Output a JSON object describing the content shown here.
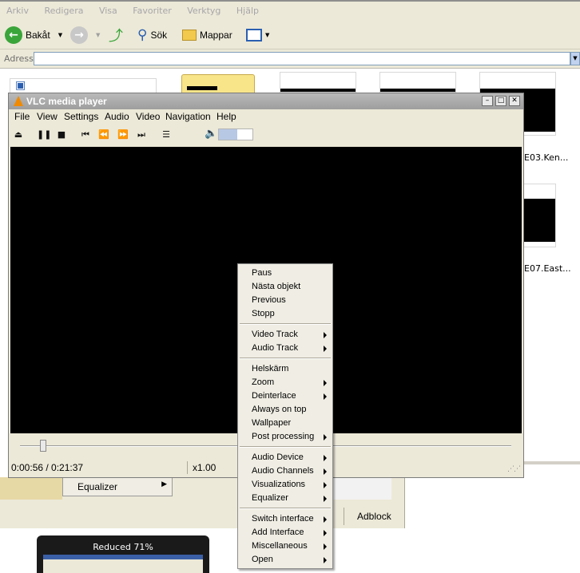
{
  "explorer": {
    "menu": [
      "Arkiv",
      "Redigera",
      "Visa",
      "Favoriter",
      "Verktyg",
      "Hjälp"
    ],
    "toolbar": {
      "back_label": "Bakåt",
      "search_label": "Sök",
      "folders_label": "Mappar"
    },
    "address_label": "Adress",
    "thumb_labels": [
      "E03.Ken...",
      "E07.East..."
    ],
    "background_menu_item": "Equalizer",
    "adblock_label": "Adblock",
    "preview_title": "Reduced 71%"
  },
  "vlc": {
    "title": "VLC media player",
    "menu": [
      "File",
      "View",
      "Settings",
      "Audio",
      "Video",
      "Navigation",
      "Help"
    ],
    "volume": 0.55,
    "time": "0:00:56 / 0:21:37",
    "speed": "x1.00"
  },
  "context_menu": {
    "groups": [
      [
        {
          "label": "Paus",
          "sub": false
        },
        {
          "label": "Nästa objekt",
          "sub": false
        },
        {
          "label": "Previous",
          "sub": false
        },
        {
          "label": "Stopp",
          "sub": false
        }
      ],
      [
        {
          "label": "Video Track",
          "sub": true
        },
        {
          "label": "Audio Track",
          "sub": true
        }
      ],
      [
        {
          "label": "Helskärm",
          "sub": false
        },
        {
          "label": "Zoom",
          "sub": true
        },
        {
          "label": "Deinterlace",
          "sub": true
        },
        {
          "label": "Always on top",
          "sub": false
        },
        {
          "label": "Wallpaper",
          "sub": false
        },
        {
          "label": "Post processing",
          "sub": true
        }
      ],
      [
        {
          "label": "Audio Device",
          "sub": true
        },
        {
          "label": "Audio Channels",
          "sub": true
        },
        {
          "label": "Visualizations",
          "sub": true
        },
        {
          "label": "Equalizer",
          "sub": true
        }
      ],
      [
        {
          "label": "Switch interface",
          "sub": true
        },
        {
          "label": "Add Interface",
          "sub": true
        },
        {
          "label": "Miscellaneous",
          "sub": true
        },
        {
          "label": "Open",
          "sub": true
        }
      ]
    ]
  }
}
